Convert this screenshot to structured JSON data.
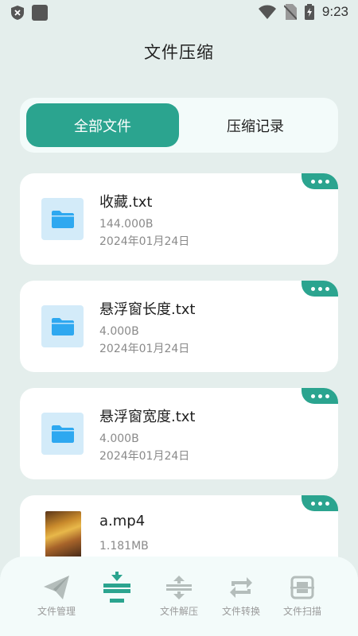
{
  "status_bar": {
    "time": "9:23"
  },
  "header": {
    "title": "文件压缩"
  },
  "tabs": [
    {
      "label": "全部文件",
      "active": true
    },
    {
      "label": "压缩记录",
      "active": false
    }
  ],
  "files": [
    {
      "name": "收藏.txt",
      "size": "144.000B",
      "date": "2024年01月24日",
      "icon": "folder-icon"
    },
    {
      "name": "悬浮窗长度.txt",
      "size": "4.000B",
      "date": "2024年01月24日",
      "icon": "folder-icon"
    },
    {
      "name": "悬浮窗宽度.txt",
      "size": "4.000B",
      "date": "2024年01月24日",
      "icon": "folder-icon"
    },
    {
      "name": "a.mp4",
      "size": "1.181MB",
      "date": "",
      "icon": "video-thumbnail"
    }
  ],
  "bottom_nav": [
    {
      "label": "文件管理",
      "icon": "paper-plane-icon",
      "active": false
    },
    {
      "label": "",
      "icon": "compress-icon",
      "active": true
    },
    {
      "label": "文件解压",
      "icon": "decompress-icon",
      "active": false
    },
    {
      "label": "文件转换",
      "icon": "convert-icon",
      "active": false
    },
    {
      "label": "文件扫描",
      "icon": "scan-icon",
      "active": false
    }
  ],
  "colors": {
    "accent": "#2ba48f",
    "background": "#e4eeec",
    "card": "#ffffff",
    "folder": "#2ea8f0"
  }
}
